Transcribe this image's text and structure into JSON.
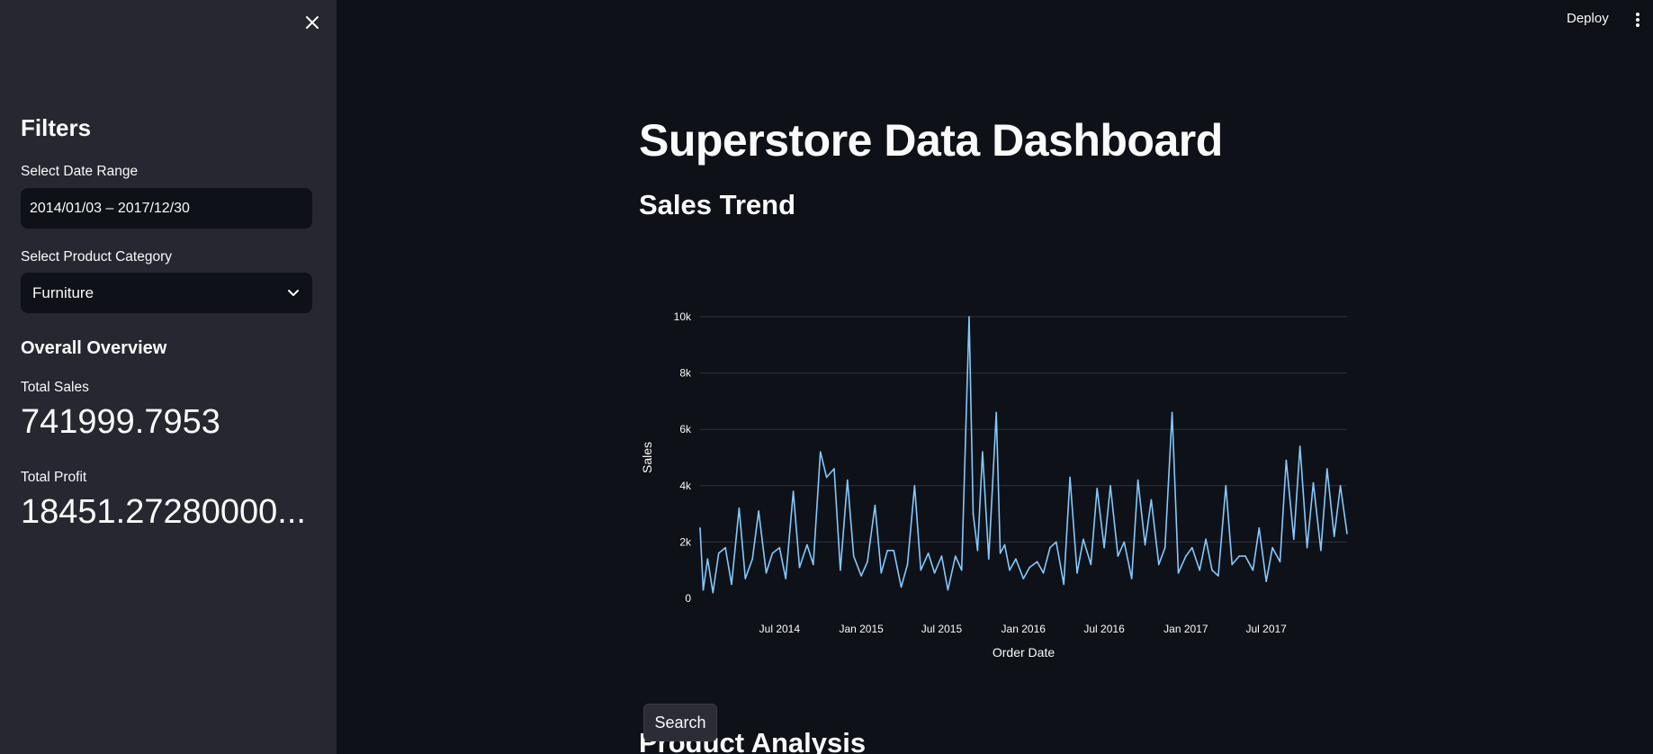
{
  "header": {
    "deploy_label": "Deploy"
  },
  "sidebar": {
    "heading": "Filters",
    "date_label": "Select Date Range",
    "date_value": "2014/01/03 – 2017/12/30",
    "category_label": "Select Product Category",
    "category_value": "Furniture",
    "overview_heading": "Overall Overview",
    "total_sales_label": "Total Sales",
    "total_sales_value": "741999.7953",
    "total_profit_label": "Total Profit",
    "total_profit_value": "18451.27280000..."
  },
  "main": {
    "title": "Superstore Data Dashboard",
    "sales_trend_heading": "Sales Trend",
    "product_analysis_heading": "Product Analysis",
    "search_button_label": "Search"
  },
  "chart_data": {
    "type": "line",
    "xlabel": "Order Date",
    "ylabel": "Sales",
    "ylim": [
      0,
      10000
    ],
    "y_ticks": [
      "0",
      "2k",
      "4k",
      "6k",
      "8k",
      "10k"
    ],
    "x_tick_labels": [
      "Jul 2014",
      "Jan 2015",
      "Jul 2015",
      "Jan 2016",
      "Jul 2016",
      "Jan 2017",
      "Jul 2017"
    ],
    "line_color": "#83c9ff",
    "grid": true,
    "series": [
      {
        "x": [
          "2014-01-03",
          "2014-01-10",
          "2014-01-20",
          "2014-02-01",
          "2014-02-14",
          "2014-03-01",
          "2014-03-15",
          "2014-04-01",
          "2014-04-15",
          "2014-05-01",
          "2014-05-15",
          "2014-06-01",
          "2014-06-15",
          "2014-07-01",
          "2014-07-15",
          "2014-08-01",
          "2014-08-15",
          "2014-09-01",
          "2014-09-15",
          "2014-10-01",
          "2014-10-15",
          "2014-11-01",
          "2014-11-15",
          "2014-12-01",
          "2014-12-15",
          "2015-01-01",
          "2015-01-15",
          "2015-02-01",
          "2015-02-15",
          "2015-03-01",
          "2015-03-15",
          "2015-04-01",
          "2015-04-15",
          "2015-05-01",
          "2015-05-15",
          "2015-06-01",
          "2015-06-15",
          "2015-07-01",
          "2015-07-15",
          "2015-08-01",
          "2015-08-15",
          "2015-09-01",
          "2015-09-10",
          "2015-09-20",
          "2015-10-01",
          "2015-10-15",
          "2015-11-01",
          "2015-11-10",
          "2015-11-20",
          "2015-12-01",
          "2015-12-15",
          "2016-01-01",
          "2016-01-15",
          "2016-02-01",
          "2016-02-15",
          "2016-03-01",
          "2016-03-15",
          "2016-04-01",
          "2016-04-15",
          "2016-05-01",
          "2016-05-15",
          "2016-06-01",
          "2016-06-15",
          "2016-07-01",
          "2016-07-15",
          "2016-08-01",
          "2016-08-15",
          "2016-09-01",
          "2016-09-15",
          "2016-10-01",
          "2016-10-15",
          "2016-11-01",
          "2016-11-15",
          "2016-12-01",
          "2016-12-15",
          "2017-01-01",
          "2017-01-15",
          "2017-02-01",
          "2017-02-15",
          "2017-03-01",
          "2017-03-15",
          "2017-04-01",
          "2017-04-15",
          "2017-05-01",
          "2017-05-15",
          "2017-06-01",
          "2017-06-15",
          "2017-07-01",
          "2017-07-15",
          "2017-08-01",
          "2017-08-15",
          "2017-09-01",
          "2017-09-15",
          "2017-10-01",
          "2017-10-15",
          "2017-11-01",
          "2017-11-15",
          "2017-12-01",
          "2017-12-15",
          "2017-12-30"
        ],
        "y": [
          2500,
          300,
          1400,
          200,
          1600,
          1800,
          500,
          3200,
          700,
          1400,
          3100,
          900,
          1600,
          1800,
          700,
          3800,
          1100,
          1900,
          1200,
          5200,
          4300,
          4600,
          1000,
          4200,
          1500,
          800,
          1300,
          3300,
          900,
          1700,
          1700,
          400,
          1200,
          4000,
          1000,
          1600,
          900,
          1500,
          300,
          1500,
          1000,
          10000,
          3000,
          1700,
          5200,
          1400,
          6600,
          1600,
          1900,
          1000,
          1400,
          700,
          1100,
          1300,
          900,
          1800,
          2000,
          500,
          4300,
          900,
          2100,
          1200,
          3900,
          1800,
          4000,
          1500,
          2000,
          700,
          4200,
          1900,
          3500,
          1200,
          1800,
          6600,
          900,
          1500,
          1800,
          1000,
          2100,
          1000,
          800,
          4000,
          1200,
          1500,
          1500,
          1000,
          2500,
          600,
          1800,
          1300,
          4900,
          2100,
          5400,
          1800,
          4100,
          1700,
          4600,
          2200,
          4000,
          2300
        ]
      }
    ]
  }
}
